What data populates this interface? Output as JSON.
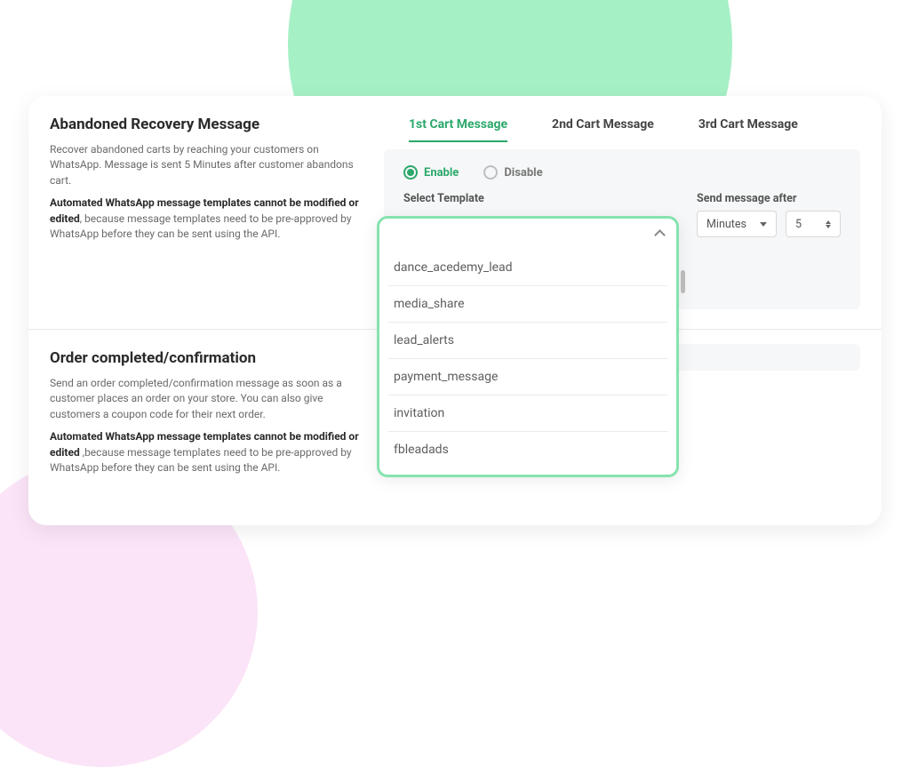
{
  "sections": {
    "abandoned": {
      "title": "Abandoned Recovery Message",
      "desc": "Recover abandoned carts by reaching your customers on WhatsApp. Message is sent 5 Minutes after customer abandons cart.",
      "note_bold": "Automated WhatsApp message templates cannot be modified or edited",
      "note_rest": ", because message templates need to be pre-approved by WhatsApp before they can be sent using the API."
    },
    "completed": {
      "title": "Order completed/confirmation",
      "desc": "Send an order completed/confirmation message as soon as a customer places an order on your store. You can also give customers a coupon code for their next order.",
      "note_bold": "Automated WhatsApp message templates cannot be modified or edited ",
      "note_rest": ",because message templates need to be pre-approved by WhatsApp before they can be sent using the API."
    }
  },
  "tabs": [
    {
      "label": "1st Cart Message",
      "active": true
    },
    {
      "label": "2nd Cart Message",
      "active": false
    },
    {
      "label": "3rd Cart Message",
      "active": false
    }
  ],
  "form": {
    "enable_label": "Enable",
    "disable_label": "Disable",
    "select_template_label": "Select Template",
    "send_after_label": "Send message after",
    "units_value": "Minutes",
    "number_value": "5"
  },
  "template_dropdown": {
    "options": [
      "dance_acedemy_lead",
      "media_share",
      "lead_alerts",
      "payment_message",
      "invitation",
      "fbleadads"
    ]
  }
}
